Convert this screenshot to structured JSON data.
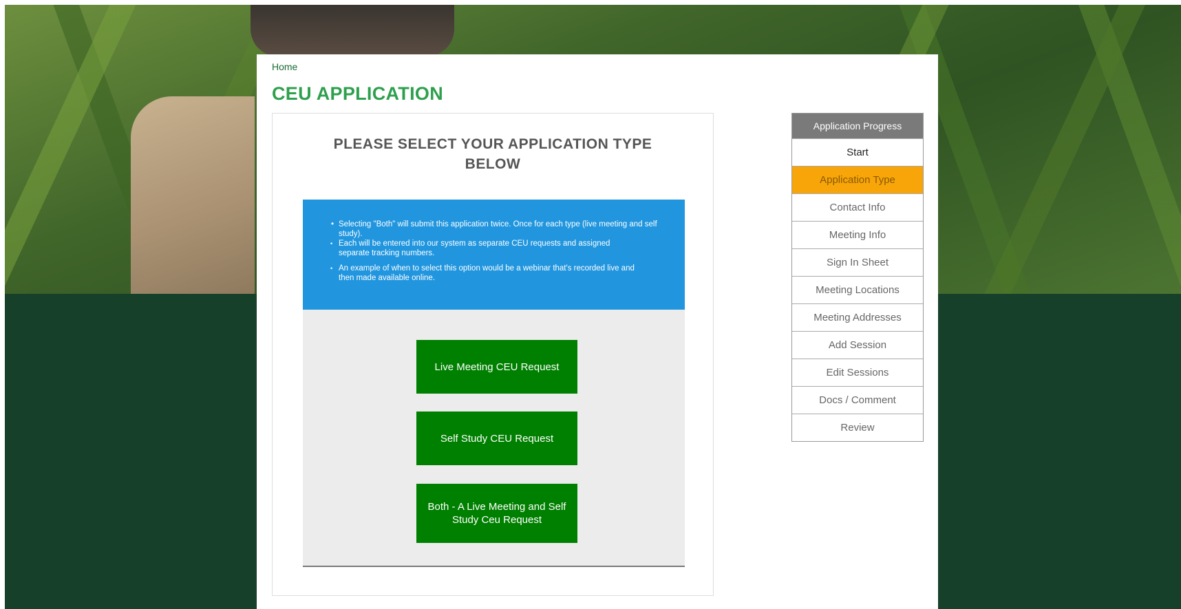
{
  "breadcrumb": {
    "home": "Home"
  },
  "page_title": "CEU APPLICATION",
  "card": {
    "heading": "PLEASE SELECT YOUR APPLICATION TYPE BELOW",
    "info": {
      "main": "Selecting \"Both\" will submit this application twice. Once for each type (live meeting and self study).",
      "sub": [
        "Each will be entered into our system as separate CEU requests and assigned separate tracking numbers.",
        "An example of when to select this option would be a webinar that's recorded live and then made available online."
      ]
    },
    "buttons": {
      "live": "Live Meeting CEU Request",
      "self": "Self Study CEU Request",
      "both": "Both - A Live Meeting and Self Study Ceu Request"
    }
  },
  "progress": {
    "header": "Application Progress",
    "steps": [
      "Start",
      "Application Type",
      "Contact Info",
      "Meeting Info",
      "Sign In Sheet",
      "Meeting Locations",
      "Meeting Addresses",
      "Add Session",
      "Edit Sessions",
      "Docs / Comment",
      "Review"
    ],
    "active_step": "Application Type"
  },
  "colors": {
    "title_green": "#2ea04d",
    "button_green": "#008000",
    "info_blue": "#2196df",
    "active_orange": "#f8a50a",
    "dark_background": "#17402a"
  }
}
